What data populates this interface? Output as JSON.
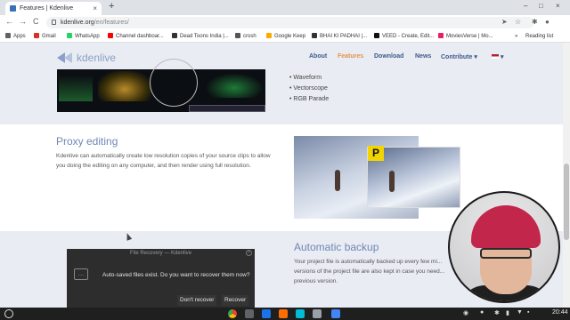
{
  "browser": {
    "tab_title": "Features | Kdenlive",
    "tab_close": "×",
    "new_tab": "+",
    "url_domain": "kdenlive.org",
    "url_path": "/en/features/",
    "window_controls": [
      "–",
      "□",
      "×"
    ],
    "nav": [
      "←",
      "→",
      "C"
    ],
    "bookmarks": [
      {
        "label": "Apps",
        "color": "#5f6368"
      },
      {
        "label": "Gmail",
        "color": "#d93025"
      },
      {
        "label": "WhatsApp",
        "color": "#25d366"
      },
      {
        "label": "Channel dashboar...",
        "color": "#ff0000"
      },
      {
        "label": "Dead Toons India |...",
        "color": "#333333"
      },
      {
        "label": "crosh",
        "color": "#555555"
      },
      {
        "label": "Google Keep",
        "color": "#f9ab00"
      },
      {
        "label": "BHAI KI PADHAI |...",
        "color": "#333333"
      },
      {
        "label": "VEED - Create, Edit...",
        "color": "#111111"
      },
      {
        "label": "MoviesVerse | Mo...",
        "color": "#e91e63"
      }
    ],
    "bookmarks_overflow": "»",
    "reading_list": "Reading list"
  },
  "site": {
    "logo": "kdenlive",
    "menu": [
      "About",
      "Features",
      "Download",
      "News",
      "Contribute ▾",
      "▾"
    ],
    "active_menu": "Features",
    "scopes_list": [
      "Waveform",
      "Vectorscope",
      "RGB Parade"
    ],
    "proxy_title": "Proxy editing",
    "proxy_text": "Kdenlive can automatically create low resolution copies of your source clips to allow you doing the editing on any computer, and then render using full resolution.",
    "proxy_badge": "P",
    "backup_title": "Automatic backup",
    "backup_text": "Your project file is automatically backed up every few mi... versions of the project file are also kept in case you need... previous version."
  },
  "dialog": {
    "title": "File Recovery — Kdenlive",
    "message": "Auto-saved files exist. Do you want to recover them now?",
    "dont_recover": "Don't recover",
    "recover": "Recover",
    "close": "×"
  },
  "taskbar": {
    "apps": [
      "#1a73e8",
      "#ea4335",
      "#34a853",
      "#fbbc04",
      "#4285f4",
      "#ff6d00",
      "#00bcd4",
      "#9aa0a6",
      "#5f6368"
    ],
    "time": "20:44"
  }
}
